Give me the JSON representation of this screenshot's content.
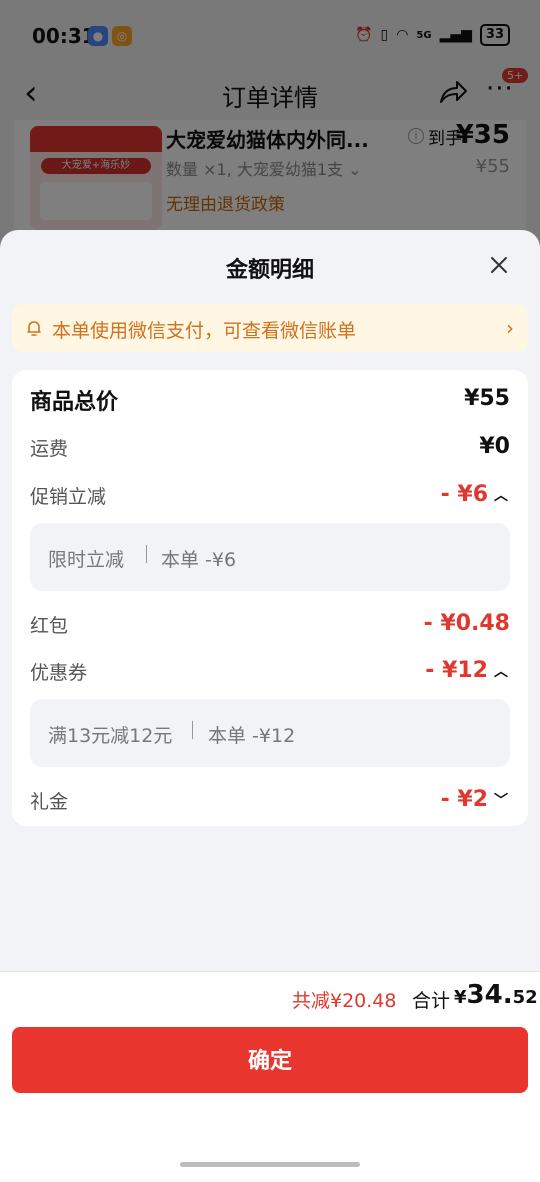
{
  "status_bar": {
    "time": "00:31",
    "signal": "5G",
    "battery": "33"
  },
  "nav": {
    "back_icon": "‹",
    "title": "订单详情",
    "badge": "5+"
  },
  "product": {
    "image_title": "大宠爱+海乐妙",
    "name": "大宠爱幼猫体内外同...",
    "spec": "数量 ×1, 大宠爱幼猫1支",
    "policy": "无理由退货政策",
    "final_label": "到手",
    "final_price": "¥35",
    "original_price": "¥55"
  },
  "sheet": {
    "title": "金额明细",
    "notice": "本单使用微信支付，可查看微信账单",
    "rows": {
      "goods_total": {
        "label": "商品总价",
        "value": "¥55"
      },
      "shipping": {
        "label": "运费",
        "value": "¥0"
      },
      "promotion": {
        "label": "促销立减",
        "value": "- ¥6",
        "detail_name": "限时立减",
        "detail_value": "本单 -¥6"
      },
      "red_packet": {
        "label": "红包",
        "value": "- ¥0.48"
      },
      "coupon": {
        "label": "优惠券",
        "value": "- ¥12",
        "detail_name": "满13元减12元",
        "detail_value": "本单 -¥12"
      },
      "gift_money": {
        "label": "礼金",
        "value": "- ¥2"
      }
    }
  },
  "footer": {
    "discount": "共减¥20.48",
    "total_label": "合计",
    "total_currency": "¥",
    "total_int": "34.",
    "total_dec": "52",
    "confirm": "确定"
  },
  "colors": {
    "accent_red": "#e8362f",
    "notice_orange": "#d0721d",
    "notice_bg": "#fff6e3"
  }
}
